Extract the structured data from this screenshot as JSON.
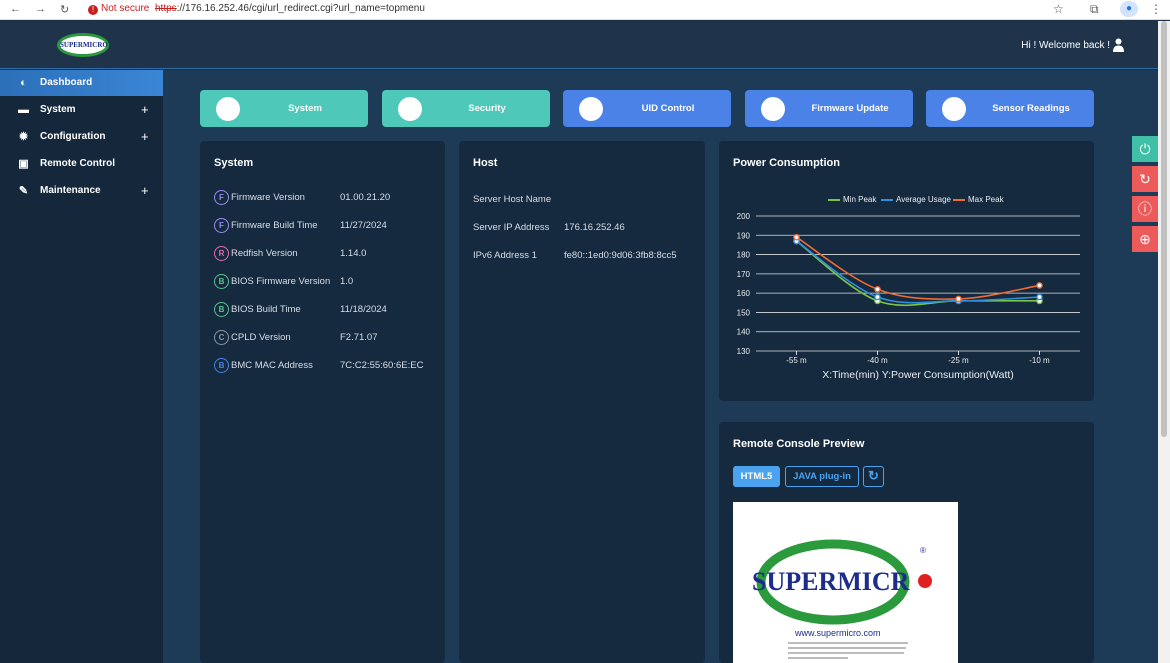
{
  "browser": {
    "not_secure": "Not secure",
    "url_scheme": "https",
    "url_rest": "://176.16.252.46/cgi/url_redirect.cgi?url_name=topmenu"
  },
  "header": {
    "logo_text": "SUPERMICRO",
    "welcome": "Hi ! Welcome back !"
  },
  "sidebar": {
    "items": [
      {
        "label": "Dashboard",
        "icon": "dashboard-icon"
      },
      {
        "label": "System",
        "icon": "monitor-icon",
        "expand": "+"
      },
      {
        "label": "Configuration",
        "icon": "gear-icon",
        "expand": "+"
      },
      {
        "label": "Remote Control",
        "icon": "terminal-icon"
      },
      {
        "label": "Maintenance",
        "icon": "wrench-icon",
        "expand": "+"
      }
    ]
  },
  "quick": [
    {
      "label": "System",
      "color": "#4ec8b8"
    },
    {
      "label": "Security",
      "color": "#4ec8b8"
    },
    {
      "label": "UID Control",
      "color": "#4a82e8"
    },
    {
      "label": "Firmware Update",
      "color": "#4a82e8"
    },
    {
      "label": "Sensor Readings",
      "color": "#4a82e8"
    }
  ],
  "system_card": {
    "title": "System",
    "rows": [
      {
        "badge": "F",
        "color": "#9b8cf0",
        "label": "Firmware Version",
        "value": "01.00.21.20"
      },
      {
        "badge": "F",
        "color": "#9b8cf0",
        "label": "Firmware Build Time",
        "value": "11/27/2024"
      },
      {
        "badge": "R",
        "color": "#e06bb0",
        "label": "Redfish Version",
        "value": "1.14.0"
      },
      {
        "badge": "B",
        "color": "#5cc18a",
        "label": "BIOS Firmware Version",
        "value": "1.0"
      },
      {
        "badge": "B",
        "color": "#5cc18a",
        "label": "BIOS Build Time",
        "value": "11/18/2024"
      },
      {
        "badge": "C",
        "color": "#8a96a3",
        "label": "CPLD Version",
        "value": "F2.71.07"
      },
      {
        "badge": "B",
        "color": "#4a82e8",
        "label": "BMC MAC Address",
        "value": "7C:C2:55:60:6E:EC"
      }
    ]
  },
  "host_card": {
    "title": "Host",
    "rows": [
      {
        "label": "Server Host Name",
        "value": ""
      },
      {
        "label": "Server IP Address",
        "value": "176.16.252.46"
      },
      {
        "label": "IPv6 Address 1",
        "value": "fe80::1ed0:9d06:3fb8:8cc5"
      }
    ]
  },
  "power_card": {
    "title": "Power Consumption"
  },
  "chart_data": {
    "type": "line",
    "categories": [
      "-55 m",
      "-40 m",
      "-25 m",
      "-10 m"
    ],
    "series": [
      {
        "name": "Min Peak",
        "color": "#7cc443",
        "values": [
          187,
          156,
          156,
          156
        ]
      },
      {
        "name": "Average Usage",
        "color": "#2e8fe0",
        "values": [
          187,
          158,
          156,
          158
        ]
      },
      {
        "name": "Max Peak",
        "color": "#f06a34",
        "values": [
          189,
          162,
          157,
          164
        ]
      }
    ],
    "ylim": [
      130,
      200
    ],
    "yticks": [
      "200",
      "190",
      "180",
      "170",
      "160",
      "150",
      "140",
      "130"
    ],
    "xlabel": "X:Time(min) Y:Power Consumption(Watt)",
    "legend_position": "top-center",
    "grid": true
  },
  "console_card": {
    "title": "Remote Console Preview",
    "html5": "HTML5",
    "java": "JAVA plug-in",
    "brand": "SUPERMICR",
    "registered": "®",
    "site": "www.supermicro.com"
  },
  "power_buttons": [
    {
      "icon": "power-icon",
      "color": "#3ebfa6"
    },
    {
      "icon": "reset-icon",
      "color": "#ec5a5a"
    },
    {
      "icon": "info-icon",
      "color": "#ec5a5a"
    },
    {
      "icon": "globe-icon",
      "color": "#ec5a5a"
    }
  ]
}
